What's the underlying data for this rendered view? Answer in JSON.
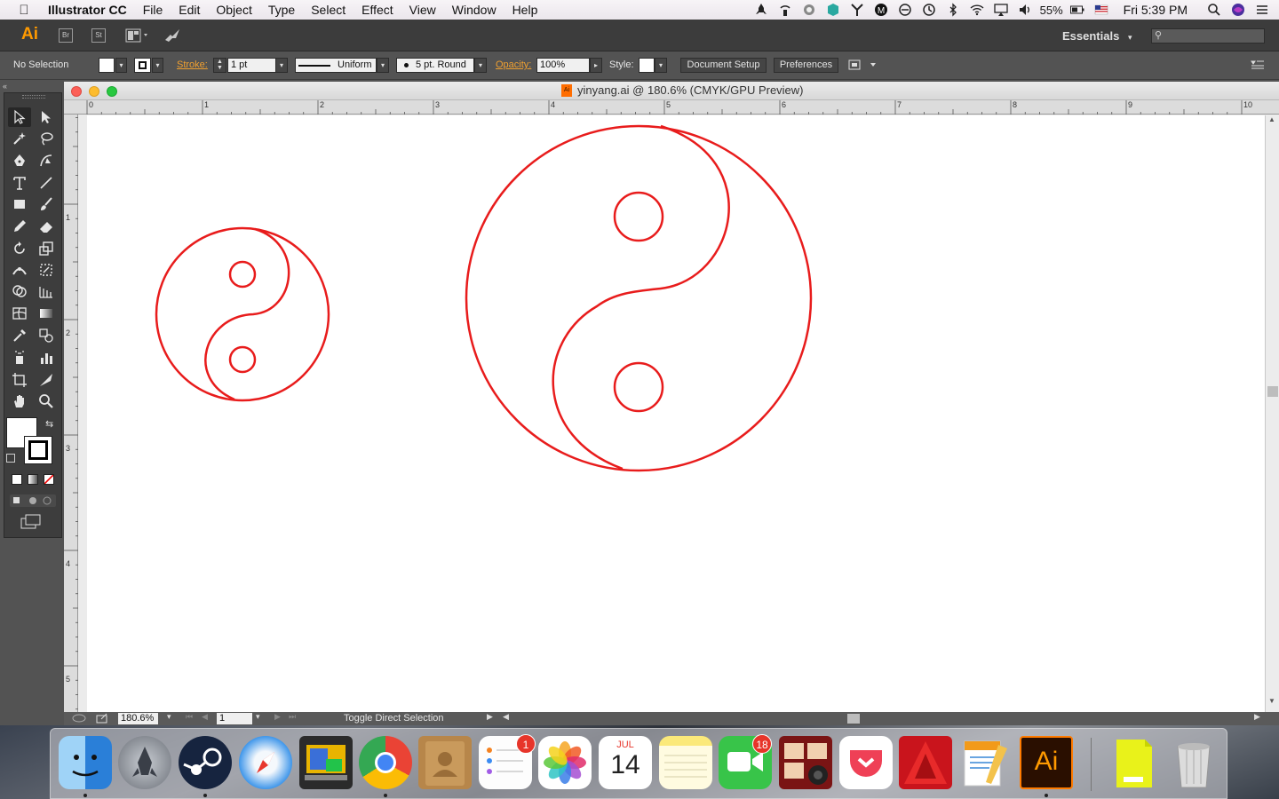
{
  "menubar": {
    "app_name": "Illustrator CC",
    "menus": [
      "File",
      "Edit",
      "Object",
      "Type",
      "Select",
      "Effect",
      "View",
      "Window",
      "Help"
    ],
    "battery": "55%",
    "clock": "Fri 5:39 PM",
    "status_icons": [
      "rocket-icon",
      "airport-icon",
      "cc-icon",
      "box-icon",
      "y-icon",
      "m-icon",
      "dnd-icon",
      "timemachine-icon",
      "bluetooth-icon",
      "wifi-icon",
      "airplay-icon",
      "volume-icon",
      "battery-icon",
      "flag-icon",
      "spotlight-icon",
      "siri-icon",
      "list-icon"
    ]
  },
  "appbar": {
    "logo": "Ai",
    "bridge": "Br",
    "stock": "St",
    "workspace": "Essentials",
    "search_placeholder": ""
  },
  "controlbar": {
    "selection": "No Selection",
    "stroke_label": "Stroke:",
    "stroke_weight": "1 pt",
    "profile": "Uniform",
    "brush": "5 pt. Round",
    "opacity_label": "Opacity:",
    "opacity": "100%",
    "style_label": "Style:",
    "document_setup": "Document Setup",
    "preferences": "Preferences"
  },
  "document": {
    "title": "yinyang.ai @ 180.6% (CMYK/GPU Preview)",
    "ruler_h": [
      "0",
      "1",
      "2",
      "3",
      "4",
      "5",
      "6",
      "7",
      "8",
      "9",
      "10"
    ],
    "ruler_v": [
      "1",
      "2",
      "3",
      "4",
      "5"
    ],
    "stroke_color": "#e81c1c"
  },
  "statusbar": {
    "zoom": "180.6%",
    "artboard": "1",
    "message": "Toggle Direct Selection"
  },
  "dock": {
    "apps": [
      "Finder",
      "Launchpad",
      "Steam",
      "Safari",
      "Image Capture",
      "Chrome",
      "Contacts",
      "Reminders",
      "Photos",
      "Calendar",
      "Notes",
      "FaceTime",
      "Photo Booth",
      "Pocket",
      "AutoCAD",
      "Pages",
      "Illustrator",
      "Documents",
      "Trash"
    ],
    "reminders_badge": "1",
    "facetime_badge": "18",
    "calendar_month": "JUL",
    "calendar_day": "14",
    "illustrator_label": "Ai"
  }
}
